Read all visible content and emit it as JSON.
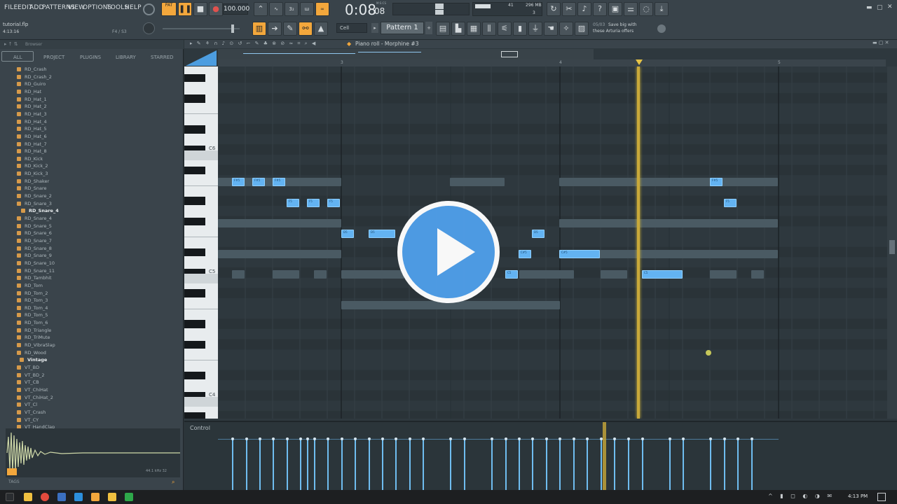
{
  "menu": [
    "FILE",
    "EDIT",
    "ADD",
    "PATTERNS",
    "VIEW",
    "OPTIONS",
    "TOOLS",
    "HELP"
  ],
  "transport": {
    "pat_label": "PAT",
    "tempo": "100.000",
    "time_main": "0:08",
    "time_sub": "08",
    "time_unit": "M:S:CS"
  },
  "meters": {
    "cpu": "41",
    "memory": "296 MB",
    "polyphony": "3"
  },
  "hint": {
    "prefix": "05/03",
    "line1": "Save big with",
    "line2": "these Arturia offers"
  },
  "project": {
    "filename": "tutorial.flp",
    "position": "4:13:16",
    "sig": "F4 / S3"
  },
  "snap": {
    "value": "Cell"
  },
  "pattern": {
    "label": "Pattern 1"
  },
  "browser": {
    "title": "Browser",
    "tabs": [
      "ALL",
      "PROJECT",
      "PLUGINS",
      "LIBRARY",
      "STARRED"
    ],
    "items": [
      "RD_Crash",
      "RD_Crash_2",
      "RD_Guiro",
      "RD_Hat",
      "RD_Hat_1",
      "RD_Hat_2",
      "RD_Hat_3",
      "RD_Hat_4",
      "RD_Hat_5",
      "RD_Hat_6",
      "RD_Hat_7",
      "RD_Hat_8",
      "RD_Kick",
      "RD_Kick_2",
      "RD_Kick_3",
      "RD_Shaker",
      "RD_Snare",
      "RD_Snare_2",
      "RD_Snare_3",
      "RD_Snare_4",
      "RD_Snare_5",
      "RD_Snare_6",
      "RD_Snare_7",
      "RD_Snare_8",
      "RD_Snare_9",
      "RD_Snare_10",
      "RD_Snare_11",
      "RD_Tambhit",
      "RD_Tom",
      "RD_Tom_2",
      "RD_Tom_3",
      "RD_Tom_4",
      "RD_Tom_5",
      "RD_Tom_6",
      "RD_Triangle",
      "RD_TriMute",
      "RD_VibraSlap",
      "RD_Wood",
      "Vintage",
      "VT_BD",
      "VT_BD_2",
      "VT_CB",
      "VT_ChiHat",
      "VT_ChiHat_2",
      "VT_Cl",
      "VT_Crash",
      "VT_CY",
      "VT_HandClap"
    ],
    "selected": "RD_Snare_4",
    "folder": "Vintage",
    "tags_label": "TAGS",
    "waveform_info": "44.1 kHz 32"
  },
  "pianoroll": {
    "title": "Piano roll - Morphine #3",
    "octave_labels": [
      "C6",
      "C5",
      "C4"
    ],
    "bar_numbers": [
      "3",
      "4",
      "5"
    ],
    "control_label": "Control"
  },
  "clock": {
    "time": "4:13 PM"
  },
  "colors": {
    "accent": "#f3a73c",
    "note": "#63b3f2",
    "playhead": "#d9b93a"
  }
}
